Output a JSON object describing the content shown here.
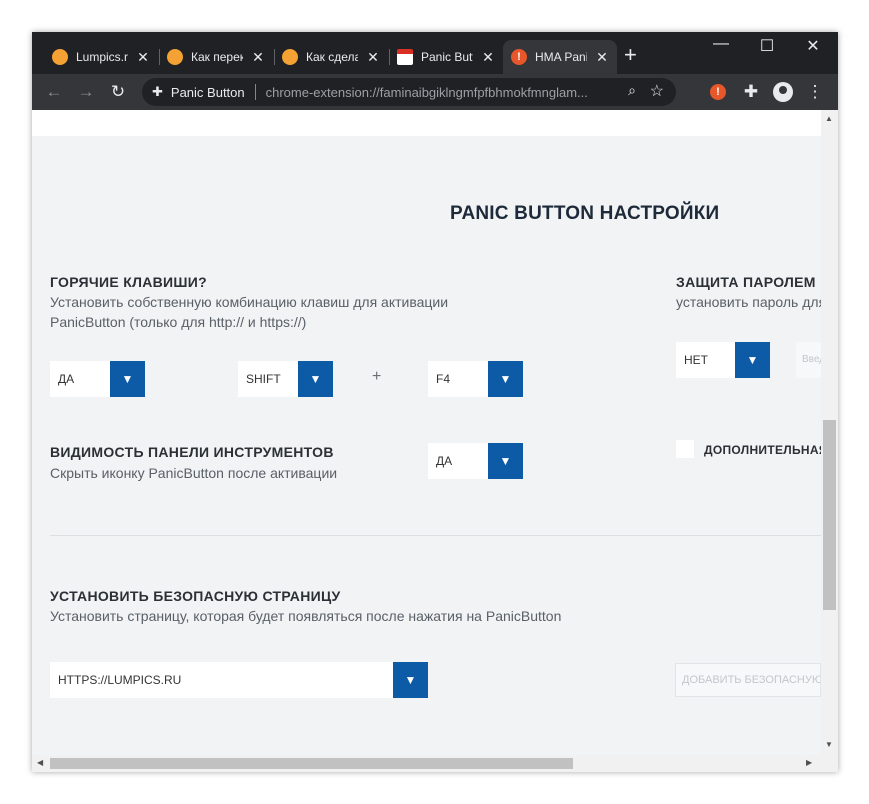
{
  "browser": {
    "tabs": [
      {
        "title": "Lumpics.ru",
        "favicon_color": "#f4a233",
        "active": false
      },
      {
        "title": "Как переключаться",
        "favicon_color": "#f4a233",
        "active": false
      },
      {
        "title": "Как сделать",
        "favicon_color": "#f4a233",
        "active": false
      },
      {
        "title": "Panic Button",
        "favicon_color": "#d93025",
        "active": false
      },
      {
        "title": "HMA Panic",
        "favicon_color": "#e8572a",
        "active": true
      }
    ],
    "new_tab": "+",
    "window_controls": {
      "minimize": "—",
      "maximize": "☐",
      "close": "✕"
    },
    "omnibox": {
      "site_label": "Panic Button",
      "url": "chrome-extension://faminaibgiklngmfpfbhmokfmnglam..."
    },
    "icons": [
      "back-icon",
      "forward-icon",
      "reload-icon",
      "puzzle-icon",
      "zoom-icon",
      "star-icon",
      "extension-alert-icon",
      "extensions-icon",
      "profile-icon",
      "menu-icon"
    ]
  },
  "settings": {
    "heading": "PANIC BUTTON НАСТРОЙКИ",
    "hotkeys": {
      "title": "ГОРЯЧИЕ КЛАВИШИ?",
      "desc_line1": "Установить собственную комбинацию клавиш для активации",
      "desc_line2": "PanicButton (только для http:// и https://)",
      "enabled_value": "ДА",
      "modifier_value": "SHIFT",
      "plus": "+",
      "key_value": "F4"
    },
    "password": {
      "title": "ЗАЩИТА ПАРОЛЕМ",
      "desc": "установить пароль для",
      "value": "НЕТ",
      "input_placeholder": "Введите"
    },
    "toolbar_visibility": {
      "title": "ВИДИМОСТЬ ПАНЕЛИ ИНСТРУМЕНТОВ",
      "desc": "Скрыть иконку PanicButton после активации",
      "value": "ДА"
    },
    "extra": {
      "label": "ДОПОЛНИТЕЛЬНАЯ"
    },
    "safe_page": {
      "title": "УСТАНОВИТЬ БЕЗОПАСНУЮ СТРАНИЦУ",
      "desc": "Установить страницу, которая будет появляться после нажатия на PanicButton",
      "value": "HTTPS://LUMPICS.RU",
      "add_button": "ДОБАВИТЬ БЕЗОПАСНУЮ"
    }
  },
  "colors": {
    "accent": "#0d5aa7",
    "page_bg": "#f1f3f4",
    "tabstrip_bg": "#202124",
    "toolbar_bg": "#35363a"
  }
}
